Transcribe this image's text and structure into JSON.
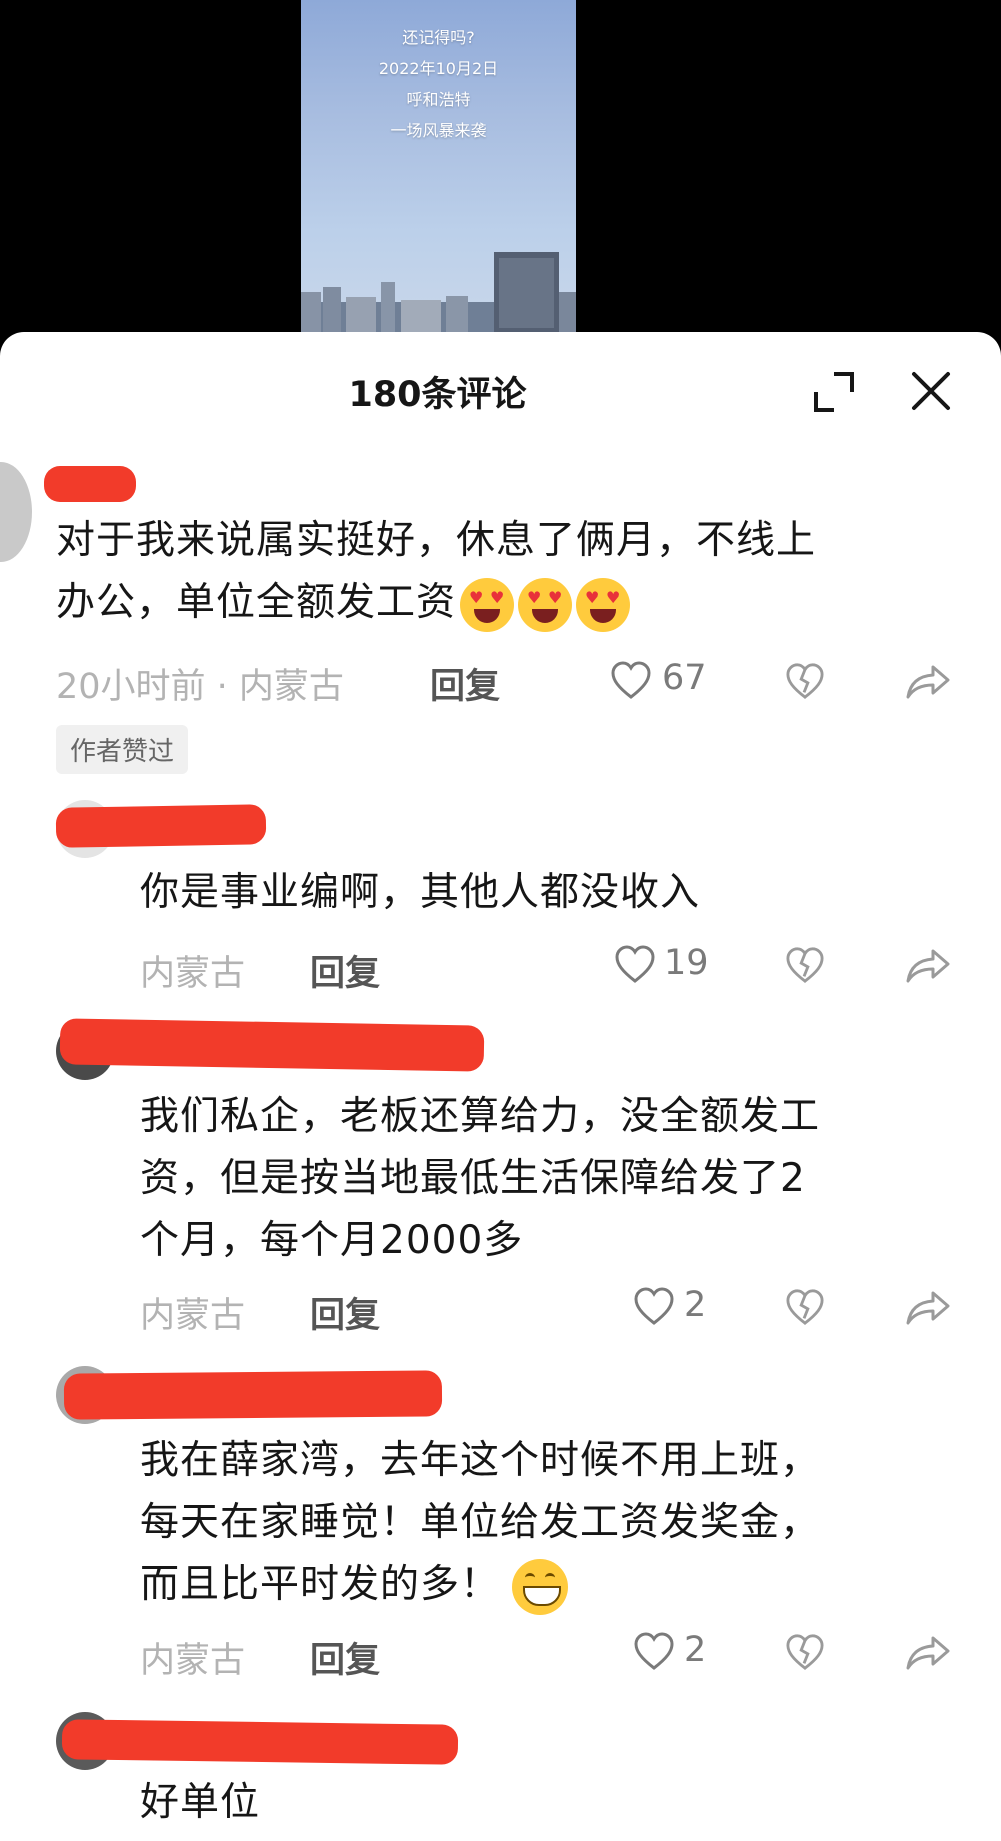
{
  "video": {
    "caption_lines": [
      "还记得吗?",
      "2022年10月2日",
      "呼和浩特",
      "一场风暴来袭"
    ]
  },
  "sheet": {
    "title": "180条评论",
    "expand_icon": "expand-icon",
    "close_icon": "close-icon"
  },
  "comments": [
    {
      "text_line1": "对于我来说属实挺好，休息了俩月，不线上",
      "text_line2": "办公，单位全额发工资",
      "emoji": "heart-eyes-tongue-emoji",
      "meta": "20小时前 · 内蒙古",
      "reply_label": "回复",
      "likes": "67",
      "badge": "作者赞过"
    },
    {
      "text": "你是事业编啊，其他人都没收入",
      "meta": "内蒙古",
      "reply_label": "回复",
      "likes": "19"
    },
    {
      "lines": [
        "我们私企，老板还算给力，没全额发工",
        "资，但是按当地最低生活保障给发了2",
        "个月，每个月2000多"
      ],
      "meta": "内蒙古",
      "reply_label": "回复",
      "likes": "2"
    },
    {
      "lines": [
        "我在薛家湾，去年这个时候不用上班，",
        "每天在家睡觉！单位给发工资发奖金，",
        "而且比平时发的多！"
      ],
      "emoji": "grinning-emoji",
      "meta": "内蒙古",
      "reply_label": "回复",
      "likes": "2"
    },
    {
      "text": "好单位"
    }
  ],
  "colors": {
    "redaction": "#f23b2a",
    "text": "#161616",
    "meta": "#b3b3b3"
  }
}
